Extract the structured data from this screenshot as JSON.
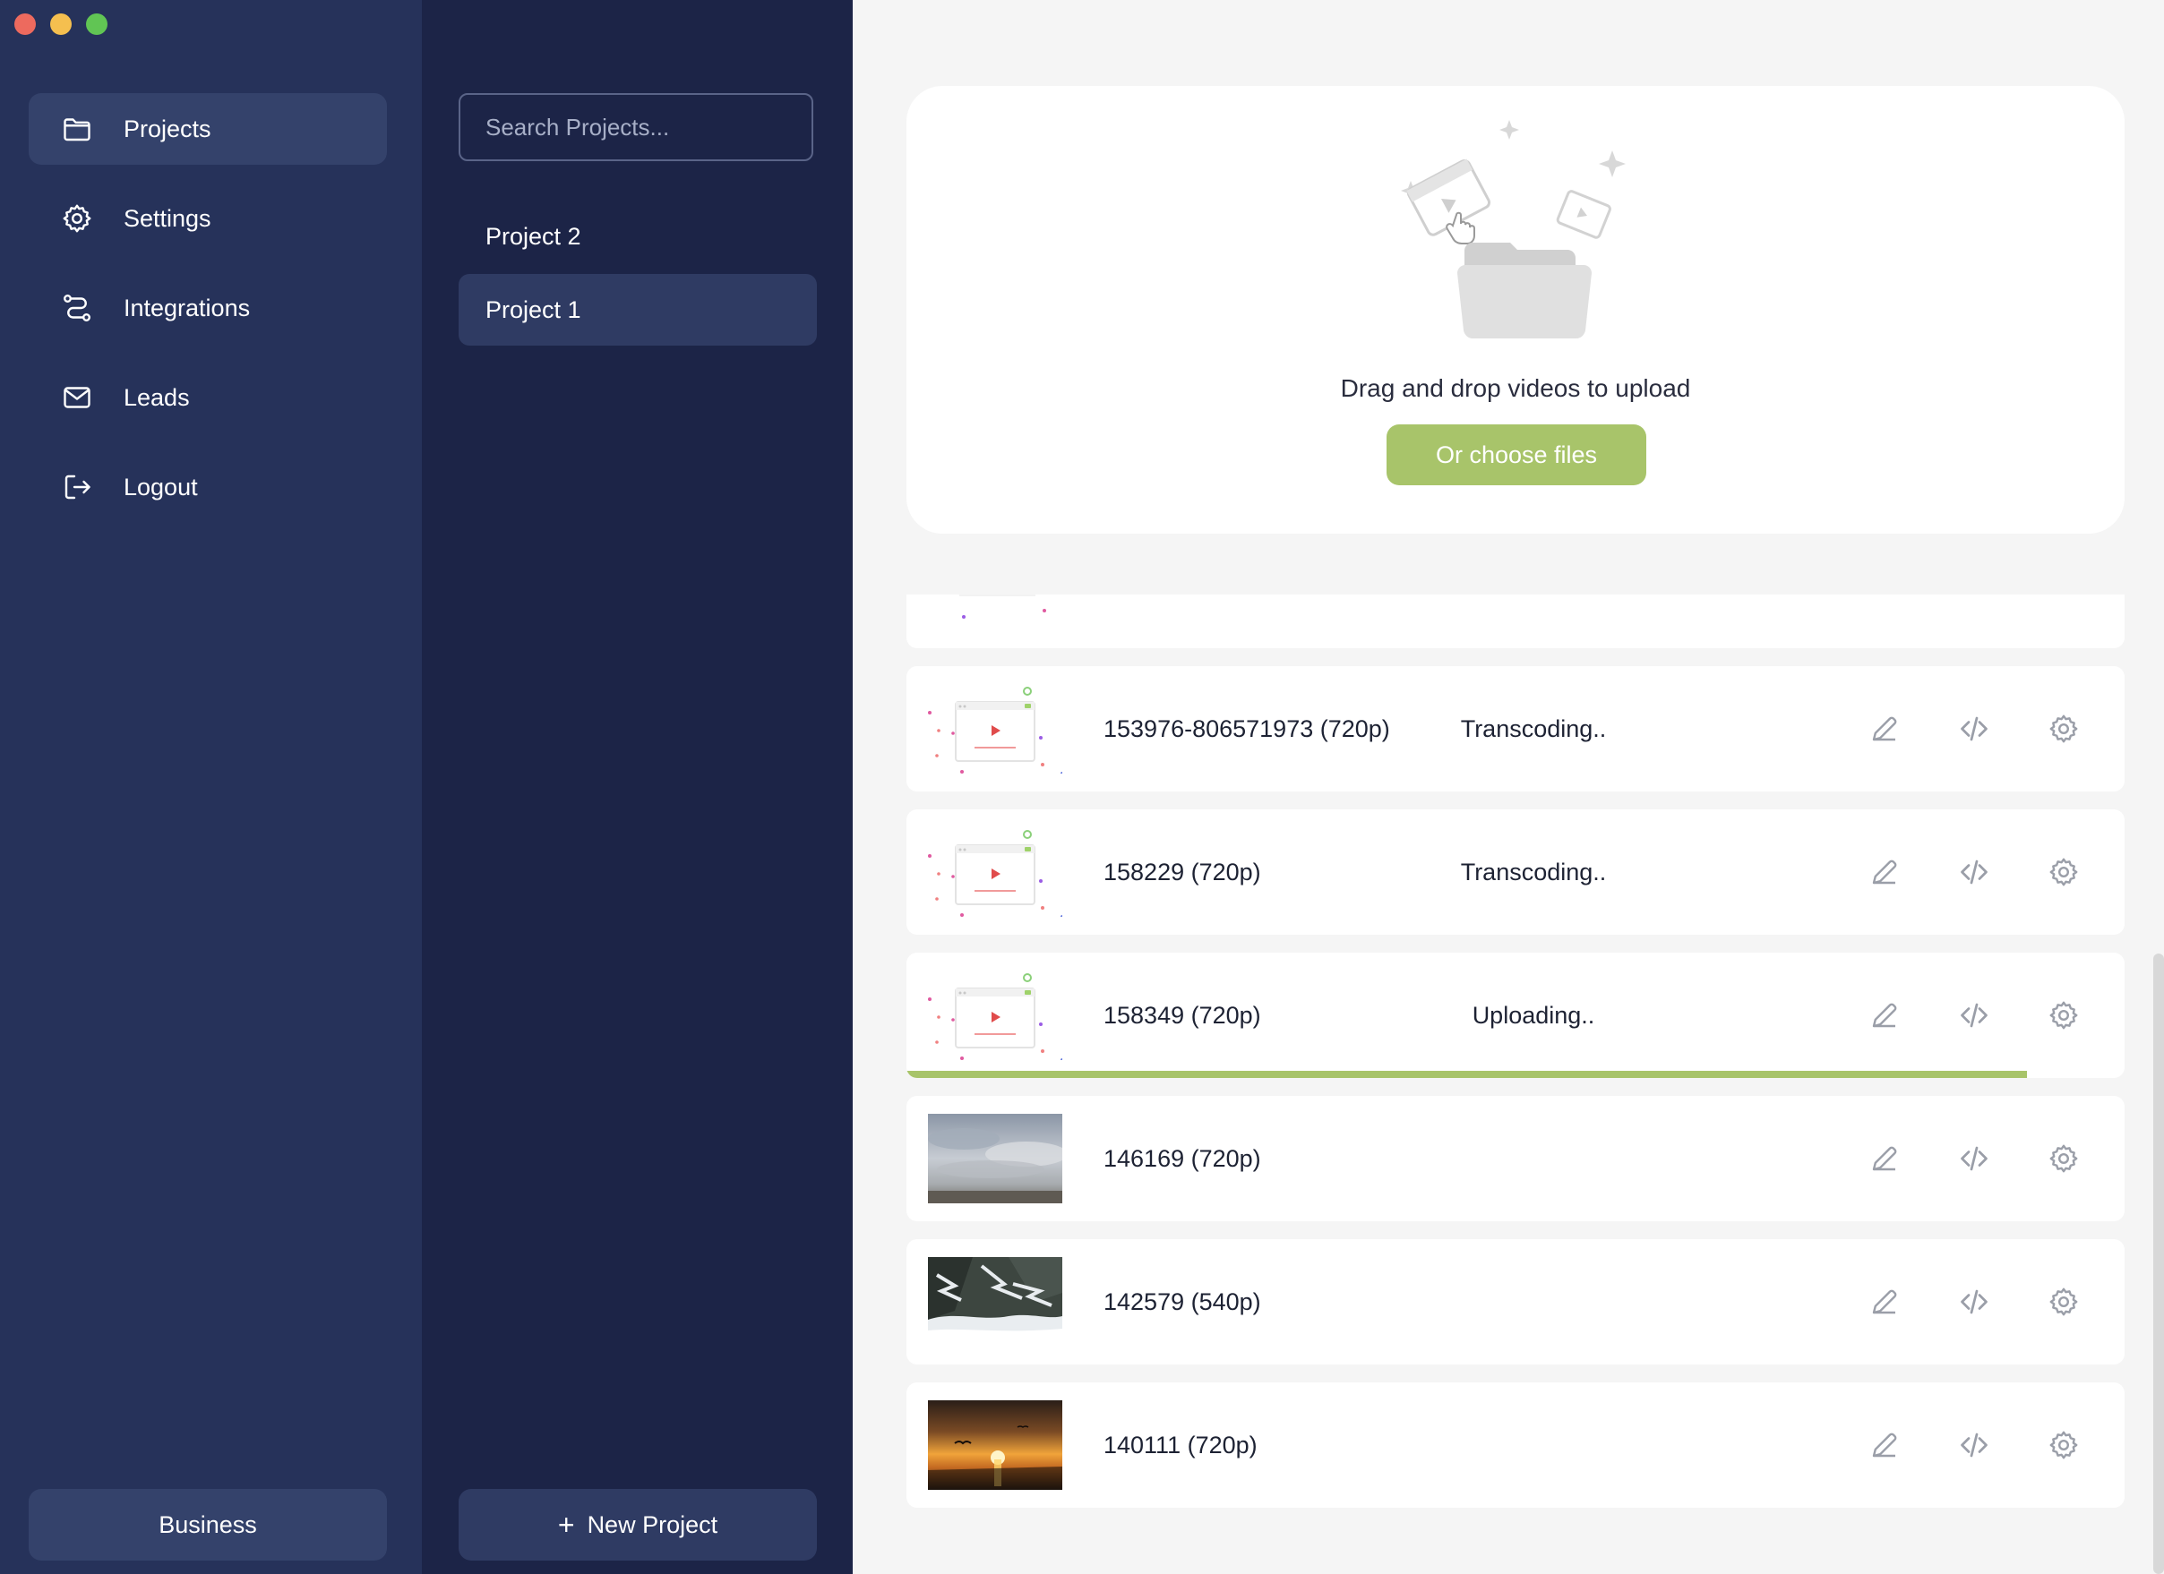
{
  "window": {
    "controls": [
      "close",
      "minimize",
      "maximize"
    ]
  },
  "nav": {
    "items": [
      {
        "label": "Projects",
        "icon": "folder-icon",
        "active": true
      },
      {
        "label": "Settings",
        "icon": "gear-icon",
        "active": false
      },
      {
        "label": "Integrations",
        "icon": "route-icon",
        "active": false
      },
      {
        "label": "Leads",
        "icon": "mail-icon",
        "active": false
      },
      {
        "label": "Logout",
        "icon": "logout-icon",
        "active": false
      }
    ],
    "plan_label": "Business"
  },
  "projects": {
    "search_placeholder": "Search Projects...",
    "items": [
      {
        "label": "Project 2",
        "active": false
      },
      {
        "label": "Project 1",
        "active": true
      }
    ],
    "new_project_label": "New Project"
  },
  "upload": {
    "drop_text": "Drag and drop videos to upload",
    "choose_label": "Or choose files"
  },
  "videos": [
    {
      "name": "153976-806571973 (720p)",
      "status": "Transcoding..",
      "thumb": "placeholder"
    },
    {
      "name": "158229 (720p)",
      "status": "Transcoding..",
      "thumb": "placeholder"
    },
    {
      "name": "158349 (720p)",
      "status": "Uploading..",
      "thumb": "placeholder",
      "progress": 0.92
    },
    {
      "name": "146169 (720p)",
      "status": "",
      "thumb": "clouds"
    },
    {
      "name": "142579 (540p)",
      "status": "",
      "thumb": "snow-forest"
    },
    {
      "name": "140111 (720p)",
      "status": "",
      "thumb": "sunset"
    }
  ],
  "colors": {
    "nav_bg": "#26325a",
    "projects_bg": "#1c2447",
    "accent": "#a8c46a",
    "main_bg": "#f5f5f5"
  }
}
